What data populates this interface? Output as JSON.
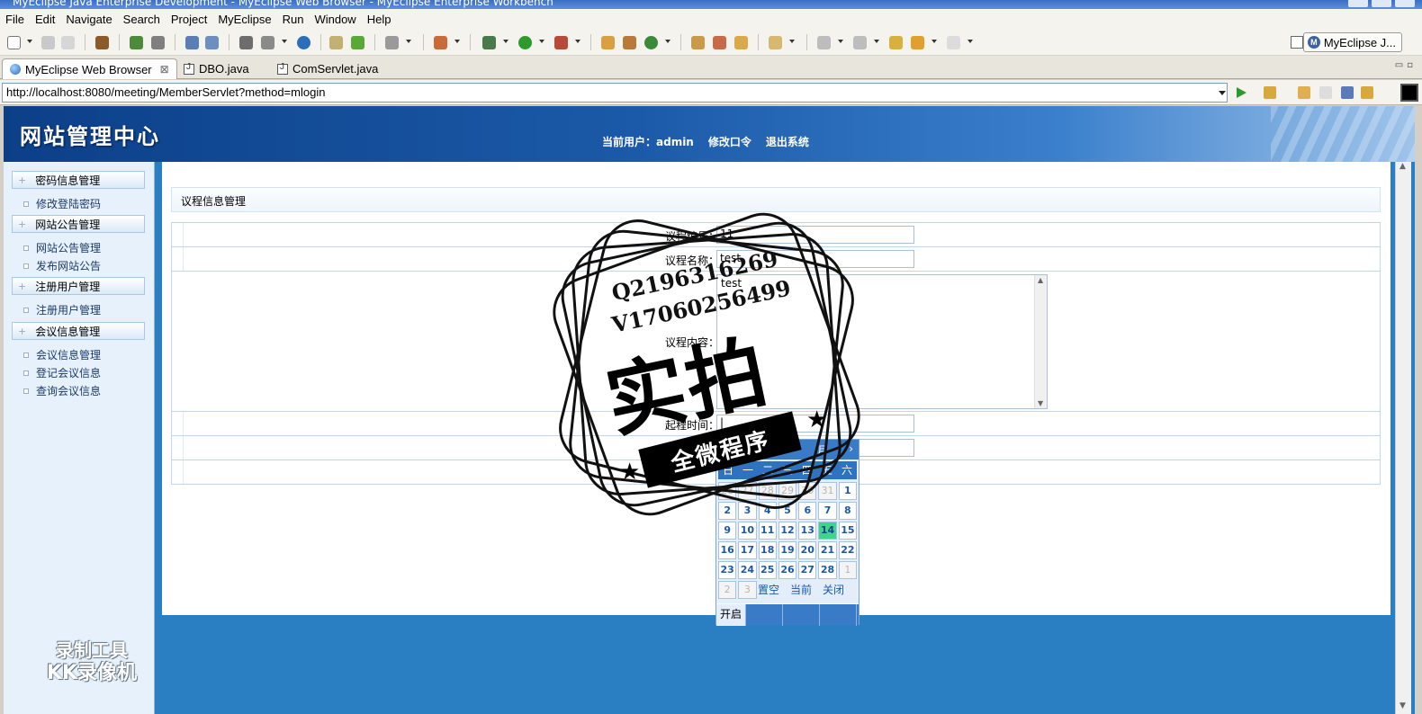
{
  "window": {
    "title": "MyEclipse Java Enterprise Development - MyEclipse Web Browser - MyEclipse Enterprise Workbench"
  },
  "menu": [
    "File",
    "Edit",
    "Navigate",
    "Search",
    "Project",
    "MyEclipse",
    "Run",
    "Window",
    "Help"
  ],
  "perspective": {
    "label": "MyEclipse J...",
    "badge": "M"
  },
  "tabs": [
    {
      "label": "MyEclipse Web Browser",
      "close": "⊠"
    },
    {
      "label": "DBO.java"
    },
    {
      "label": "ComServlet.java"
    }
  ],
  "browser": {
    "url": "http://localhost:8080/meeting/MemberServlet?method=mlogin"
  },
  "site": {
    "title": "网站管理中心",
    "links": [
      "当前用户：admin",
      "修改口令",
      "退出系统"
    ]
  },
  "sidebar": {
    "groups": [
      {
        "label": "密码信息管理",
        "items": [
          "修改登陆密码"
        ]
      },
      {
        "label": "网站公告管理",
        "items": [
          "网站公告管理",
          "发布网站公告"
        ]
      },
      {
        "label": "注册用户管理",
        "items": [
          "注册用户管理"
        ]
      },
      {
        "label": "会议信息管理",
        "items": [
          "会议信息管理",
          "登记会议信息",
          "查询会议信息"
        ]
      }
    ],
    "plus": "+",
    "watermark": [
      "录制工具",
      "KK录像机"
    ]
  },
  "panel": {
    "title": "议程信息管理"
  },
  "form": {
    "number_label": "议程编号：",
    "number_value": "11",
    "name_label": "议程名称：",
    "name_value": "test",
    "content_label": "议程内容：",
    "content_value": "test",
    "start_label": "起程时间：",
    "start_value": "|"
  },
  "calendar": {
    "month_label": "月",
    "next": "›",
    "weekdays": [
      "日",
      "一",
      "二",
      "三",
      "四",
      "五",
      "六"
    ],
    "days": [
      [
        "26",
        "27",
        "28",
        "29",
        "30",
        "31",
        "1"
      ],
      [
        "2",
        "3",
        "4",
        "5",
        "6",
        "7",
        "8"
      ],
      [
        "9",
        "10",
        "11",
        "12",
        "13",
        "14",
        "15"
      ],
      [
        "16",
        "17",
        "18",
        "19",
        "20",
        "21",
        "22"
      ],
      [
        "23",
        "24",
        "25",
        "26",
        "27",
        "28",
        "1"
      ]
    ],
    "tail_days": [
      "2",
      "3"
    ],
    "today": "14",
    "actions": [
      "置空",
      "当前",
      "关闭"
    ],
    "footer": "开启"
  },
  "stamp": {
    "line1": "Q2196316269",
    "line2": "V17060256499",
    "big": "实拍",
    "ribbon": "全微程序"
  }
}
